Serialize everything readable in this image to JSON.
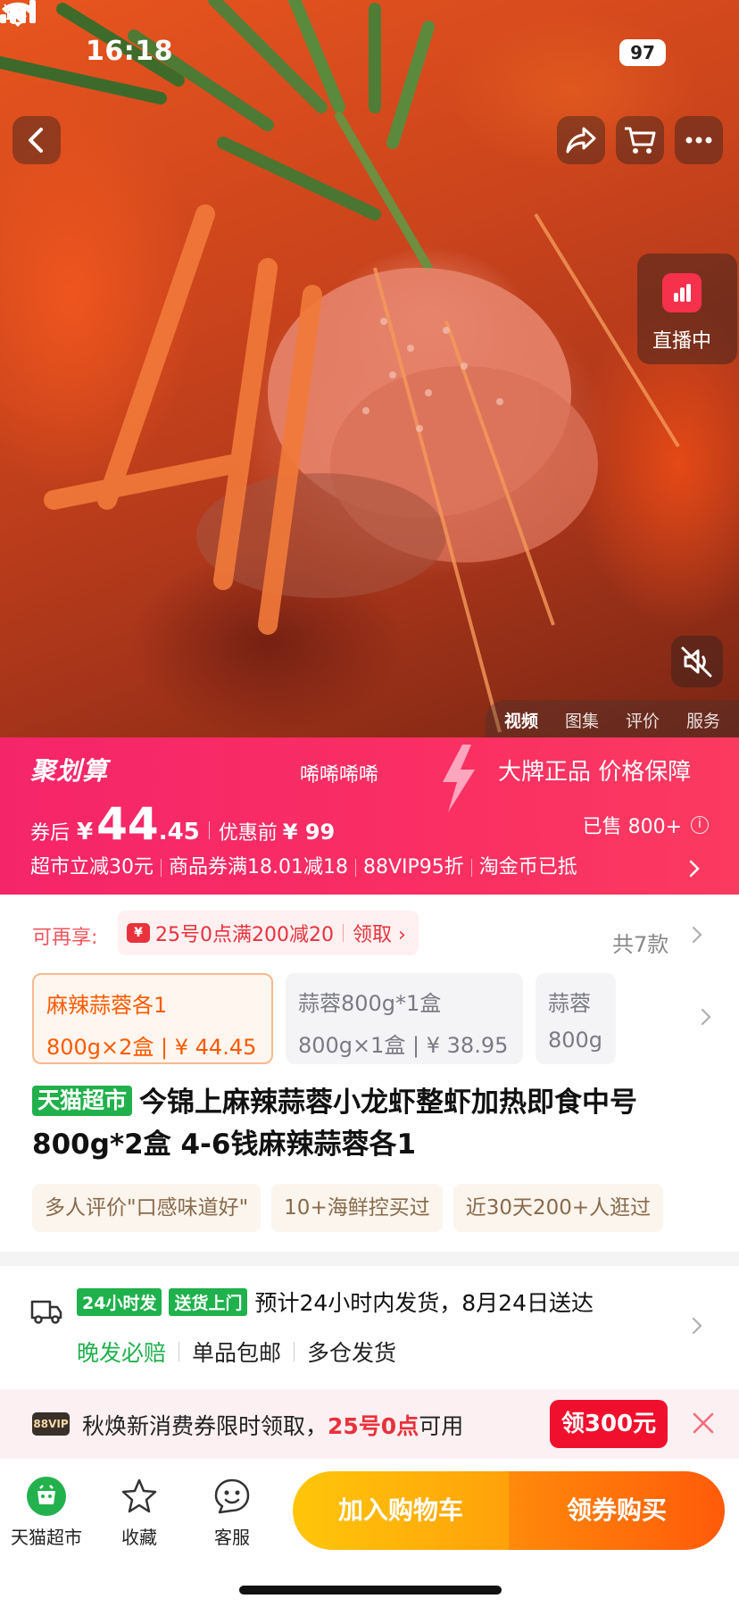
{
  "status_bar": {
    "time": "16:18",
    "battery": "97"
  },
  "hero": {
    "live_label": "直播中",
    "media_tabs": [
      "视频",
      "图集",
      "评价",
      "服务"
    ]
  },
  "promo": {
    "brand": "聚划算",
    "slogan": "唏唏唏唏",
    "guarantee": "大牌正品 价格保障",
    "after_coupon_label": "券后",
    "currency": "¥",
    "price_int": "44",
    "price_dec": ".45",
    "before_label": "优惠前",
    "before_price": "¥ 99",
    "sold": "已售 800+",
    "info_glyph": "i",
    "benefits": [
      "超市立减30元",
      "商品券满18.01减18",
      "88VIP95折",
      "淘金币已抵"
    ]
  },
  "coupon": {
    "label": "可再享:",
    "icon_glyph": "¥",
    "text": "25号0点满200减20",
    "action": "领取 ›"
  },
  "skus": [
    {
      "line1": "麻辣蒜蓉各1",
      "line2": "800g×2盒 | ¥ 44.45"
    },
    {
      "line1": "蒜蓉800g*1盒",
      "line2": "800g×1盒 | ¥ 38.95"
    },
    {
      "line1": "蒜蓉",
      "line2": "800g"
    }
  ],
  "sku_total": "共7款",
  "product": {
    "store_tag": "天猫超市",
    "title": "今锦上麻辣蒜蓉小龙虾整虾加热即食中号800g*2盒 4-6钱麻辣蒜蓉各1"
  },
  "tags": [
    "多人评价\"口感味道好\"",
    "10+海鲜控买过",
    "近30天200+人逛过"
  ],
  "delivery": {
    "badge_24h": "24小时发",
    "badge_door": "送货上门",
    "estimate": "预计24小时内发货，8月24日送达",
    "features": [
      "晚发必赔",
      "单品包邮",
      "多仓发货"
    ]
  },
  "vip_banner": {
    "badge": "88VIP",
    "text_a": "秋焕新消费券限时领取，",
    "text_highlight": "25号0点",
    "text_b": "可用",
    "button": "领300元"
  },
  "bottom_bar": {
    "store": "天猫超市",
    "favorite": "收藏",
    "service": "客服",
    "add_to_cart": "加入购物车",
    "buy": "领券购买"
  },
  "colors": {
    "promo_pink": "#f5256a",
    "price_orange": "#ff5a00",
    "tmall_green": "#21b04b",
    "cart_yellow": "#ffc60a",
    "buy_orange": "#ff5a0a"
  }
}
